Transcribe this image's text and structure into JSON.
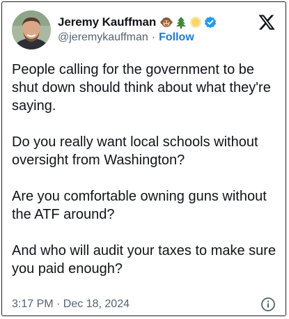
{
  "author": {
    "display_name": "Jeremy Kauffman",
    "handle": "@jeremykauffman",
    "separator": "·",
    "follow_label": "Follow",
    "name_emojis": [
      "monkey-face-icon",
      "evergreen-tree-icon",
      "sun-icon",
      "verified-badge-icon"
    ]
  },
  "brand": {
    "logo": "x-logo-icon"
  },
  "tweet": {
    "paragraphs": [
      "People calling for the government to be shut down should think about what they're saying.",
      "Do you really want local schools without oversight from Washington?",
      "Are you comfortable owning guns without the ATF around?",
      "And who will audit your taxes to make sure you paid enough?"
    ],
    "timestamp": "3:17 PM · Dec 18, 2024"
  },
  "icons": {
    "info": "info-icon"
  },
  "colors": {
    "text": "#0f1419",
    "secondary_text": "#536471",
    "follow_link": "#1d7bd3",
    "verified_blue": "#1d9bf0"
  }
}
